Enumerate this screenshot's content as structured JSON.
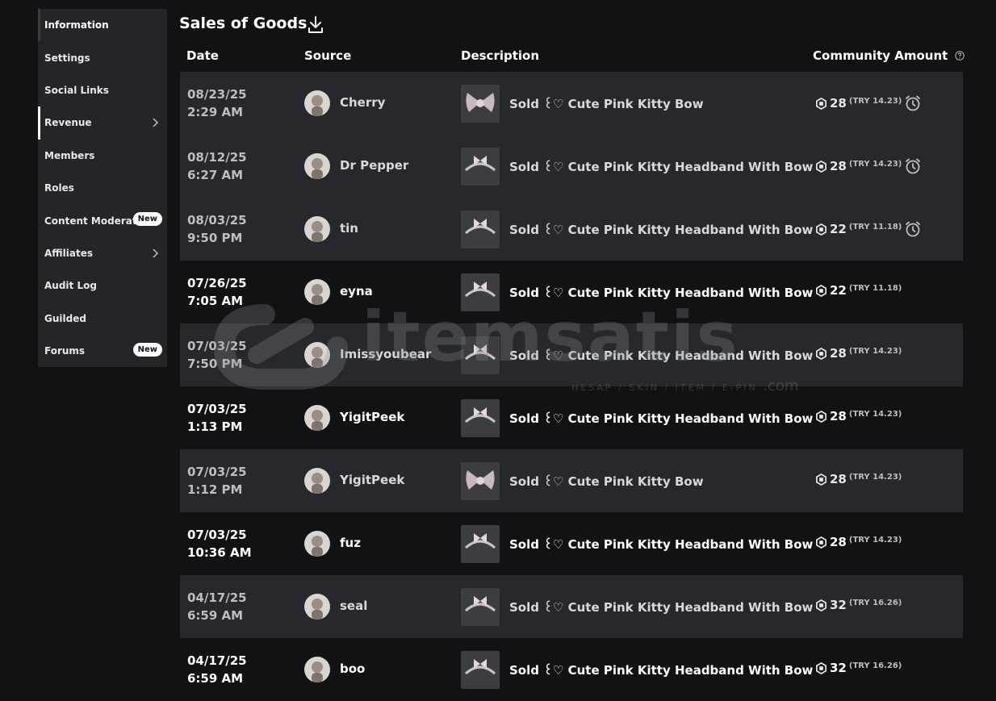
{
  "sidebar": {
    "items": [
      {
        "label": "Information"
      },
      {
        "label": "Settings"
      },
      {
        "label": "Social Links"
      },
      {
        "label": "Revenue"
      },
      {
        "label": "Members"
      },
      {
        "label": "Roles"
      },
      {
        "label": "Content Moderation",
        "badge": "New"
      },
      {
        "label": "Affiliates"
      },
      {
        "label": "Audit Log"
      },
      {
        "label": "Guilded"
      },
      {
        "label": "Forums",
        "badge": "New"
      }
    ]
  },
  "header": {
    "title": "Sales of Goods",
    "download_icon": "download-icon"
  },
  "table": {
    "columns": {
      "date": "Date",
      "source": "Source",
      "description": "Description",
      "amount": "Community Amount"
    },
    "rows": [
      {
        "date": "08/23/25",
        "time": "2:29 AM",
        "source": "Cherry",
        "description": "Sold ꒰♡ Cute Pink Kitty Bow",
        "amount": "28",
        "try": "(TRY 14.23)",
        "pending": true
      },
      {
        "date": "08/12/25",
        "time": "6:27 AM",
        "source": "Dr Pepper",
        "description": "Sold ꒰♡ Cute Pink Kitty Headband With Bow",
        "amount": "28",
        "try": "(TRY 14.23)",
        "pending": true
      },
      {
        "date": "08/03/25",
        "time": "9:50 PM",
        "source": "tin",
        "description": "Sold ꒰♡ Cute Pink Kitty Headband With Bow",
        "amount": "22",
        "try": "(TRY 11.18)",
        "pending": true
      },
      {
        "date": "07/26/25",
        "time": "7:05 AM",
        "source": "eyna",
        "description": "Sold ꒰♡ Cute Pink Kitty Headband With Bow",
        "amount": "22",
        "try": "(TRY 11.18)",
        "pending": false
      },
      {
        "date": "07/03/25",
        "time": "7:50 PM",
        "source": "Imissyoubear",
        "description": "Sold ꒰♡ Cute Pink Kitty Headband With Bow",
        "amount": "28",
        "try": "(TRY 14.23)",
        "pending": false
      },
      {
        "date": "07/03/25",
        "time": "1:13 PM",
        "source": "YigitPeek",
        "description": "Sold ꒰♡ Cute Pink Kitty Headband With Bow",
        "amount": "28",
        "try": "(TRY 14.23)",
        "pending": false
      },
      {
        "date": "07/03/25",
        "time": "1:12 PM",
        "source": "YigitPeek",
        "description": "Sold ꒰♡ Cute Pink Kitty Bow",
        "amount": "28",
        "try": "(TRY 14.23)",
        "pending": false
      },
      {
        "date": "07/03/25",
        "time": "10:36 AM",
        "source": "fuz",
        "description": "Sold ꒰♡ Cute Pink Kitty Headband With Bow",
        "amount": "28",
        "try": "(TRY 14.23)",
        "pending": false
      },
      {
        "date": "04/17/25",
        "time": "6:59 AM",
        "source": "seal",
        "description": "Sold ꒰♡ Cute Pink Kitty Headband With Bow",
        "amount": "32",
        "try": "(TRY 16.26)",
        "pending": false
      },
      {
        "date": "04/17/25",
        "time": "6:59 AM",
        "source": "boo",
        "description": "Sold ꒰♡ Cute Pink Kitty Headband With Bow",
        "amount": "32",
        "try": "(TRY 16.26)",
        "pending": false
      }
    ]
  },
  "watermark": {
    "text": "itemsatis",
    "subtext": "HESAP / SKIN / ITEM / E-PIN",
    "domain": ".com"
  },
  "colors": {
    "background": "#111214",
    "sidebar": "#232529",
    "row_shaded": "#26282d",
    "text": "#ffffff",
    "muted": "#bcbec0"
  }
}
